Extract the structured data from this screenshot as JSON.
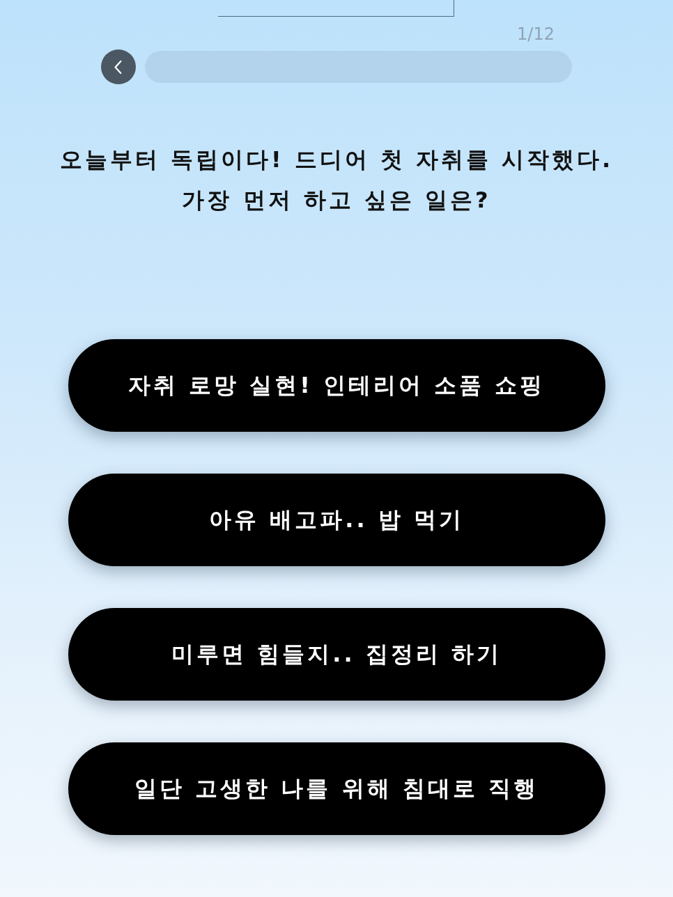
{
  "progress": {
    "counter": "1/12"
  },
  "question": {
    "lines": [
      "오늘부터 독립이다! 드디어 첫 자취를 시작했다.",
      "가장 먼저 하고 싶은 일은?"
    ]
  },
  "answers": [
    {
      "label": "자취 로망 실현! 인테리어 소품 쇼핑"
    },
    {
      "label": "아유 배고파.. 밥 먹기"
    },
    {
      "label": "미루면 힘들지.. 집정리 하기"
    },
    {
      "label": "일단 고생한 나를 위해 침대로 직행"
    }
  ]
}
